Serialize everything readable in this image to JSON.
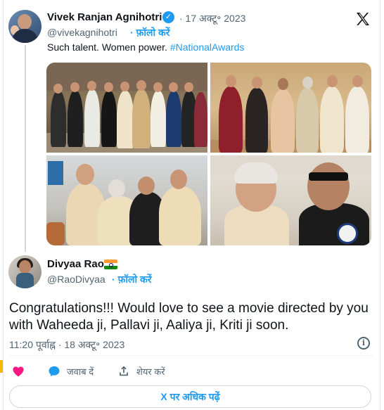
{
  "tweet": {
    "author_name": "Vivek Ranjan Agnihotri",
    "date": "· 17 अक्टू॰ 2023",
    "handle": "@vivekagnihotri",
    "follow_label": "फ़ॉलो करें",
    "text_before_tag": "Such talent. Women power. ",
    "hashtag": "#NationalAwards",
    "icons": {
      "verified": "verified-badge-icon",
      "x_logo": "x-logo-icon"
    }
  },
  "reply": {
    "author_name": "Divyaa Rao",
    "handle": "@RaoDivyaa",
    "separator": " · ",
    "follow_label": "फ़ॉलो करें",
    "text": "Congratulations!!! Would love to see a movie directed by you with Waheeda ji, Pallavi ji, Aaliya ji, Kriti ji soon.",
    "timestamp": "11:20 पूर्वाह्न · 18 अक्टू॰ 2023",
    "flag": "india-flag-icon"
  },
  "actions": {
    "reply_label": "जवाब दें",
    "share_label": "शेयर करें",
    "read_more_label": "X पर अधिक पढ़ें"
  },
  "colors": {
    "accent": "#1d9bf0",
    "like": "#f91880",
    "text_primary": "#0f1419",
    "text_secondary": "#536471"
  }
}
